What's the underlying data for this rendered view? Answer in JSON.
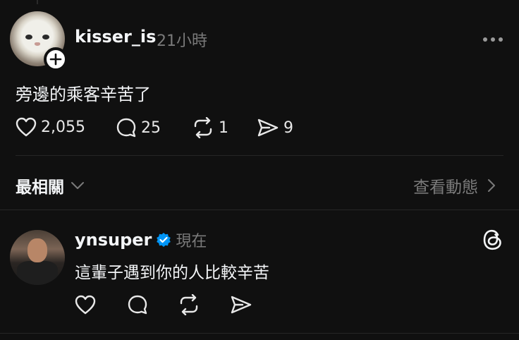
{
  "post": {
    "username": "kisser_is",
    "time": "21小時",
    "text": "旁邊的乘客辛苦了",
    "likes": "2,055",
    "comments": "25",
    "reposts": "1",
    "shares": "9"
  },
  "sort": {
    "label": "最相關",
    "view_activity": "查看動態"
  },
  "reply": {
    "username": "ynsuper",
    "time": "現在",
    "text": "這輩子遇到你的人比較辛苦",
    "verified": true
  },
  "colors": {
    "background": "#101010",
    "text": "#f3f5f7",
    "muted": "#7a7a7a",
    "verified": "#0095f6"
  },
  "icons": [
    "heart-icon",
    "comment-icon",
    "repost-icon",
    "share-icon",
    "more-icon",
    "plus-icon",
    "chevron-down-icon",
    "chevron-right-icon",
    "verified-icon",
    "threads-icon"
  ]
}
